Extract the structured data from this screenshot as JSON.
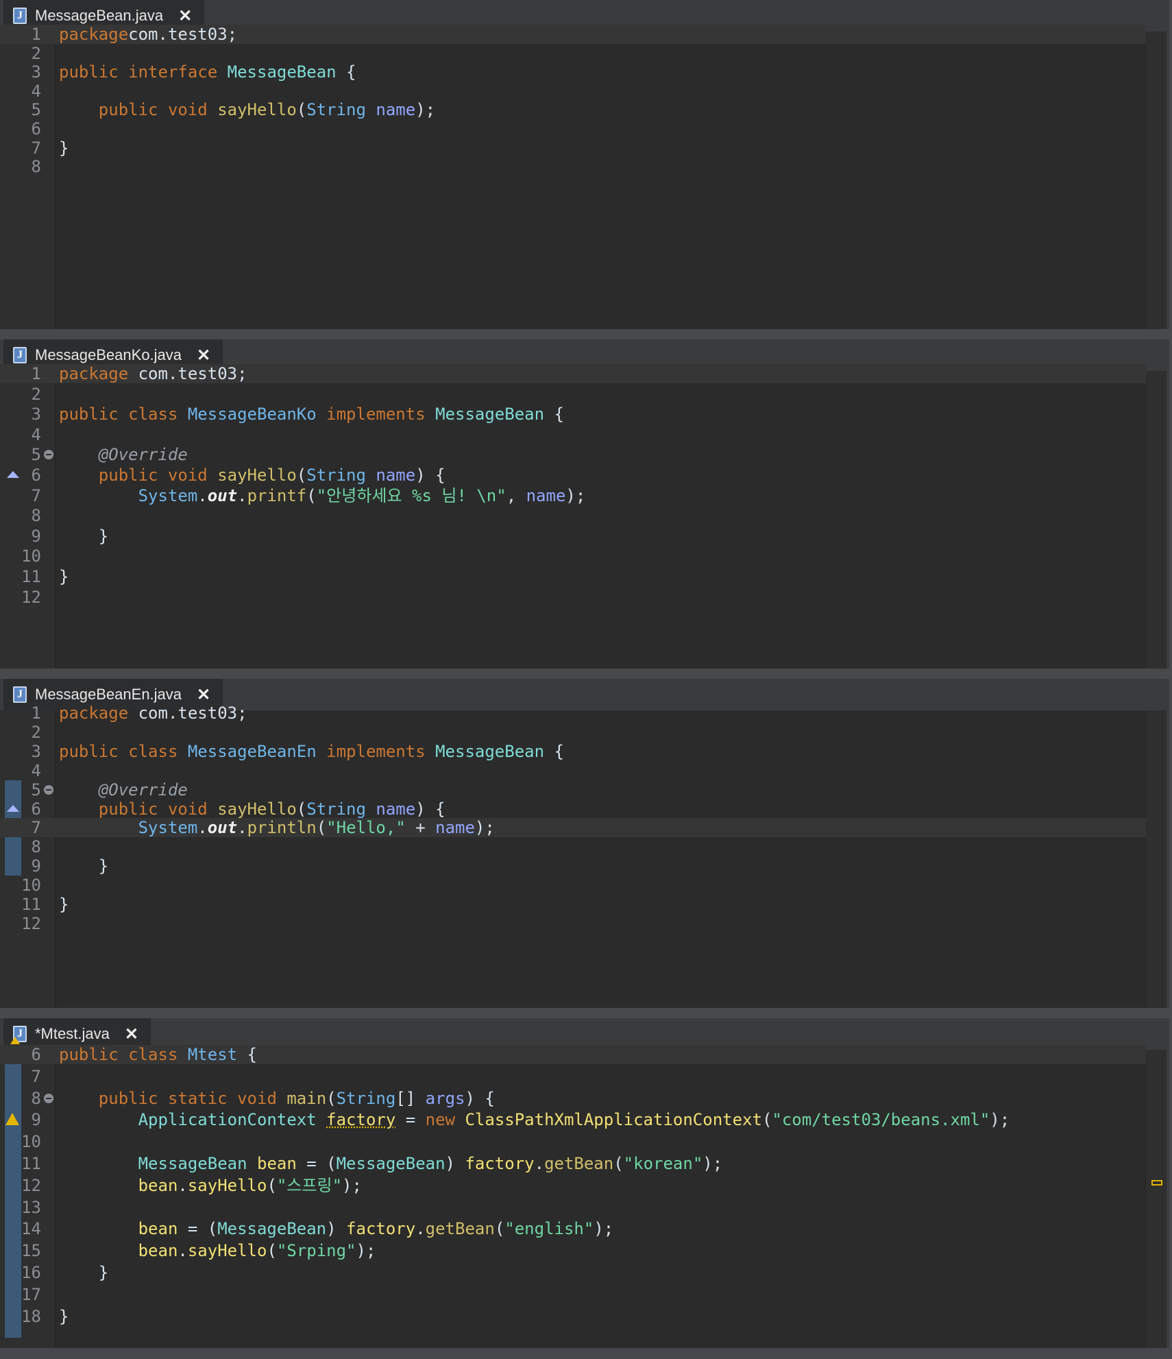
{
  "editors": [
    {
      "tab": {
        "label": "MessageBean.java",
        "close": "✕",
        "dirty": false
      },
      "lines": [
        {
          "n": "1",
          "code": [
            [
              "kw",
              "package"
            ],
            [
              "",
              "com.test03;"
            ]
          ]
        },
        {
          "n": "2",
          "code": []
        },
        {
          "n": "3",
          "code": [
            [
              "kw",
              "public"
            ],
            [
              "",
              " "
            ],
            [
              "kw",
              "interface"
            ],
            [
              "",
              " "
            ],
            [
              "ifc",
              "MessageBean"
            ],
            [
              "",
              " {"
            ]
          ]
        },
        {
          "n": "4",
          "code": []
        },
        {
          "n": "5",
          "code": [
            [
              "",
              "    "
            ],
            [
              "kw",
              "public"
            ],
            [
              "",
              " "
            ],
            [
              "kw",
              "void"
            ],
            [
              "",
              " "
            ],
            [
              "mth",
              "sayHello"
            ],
            [
              "",
              "("
            ],
            [
              "ty",
              "String"
            ],
            [
              "",
              " "
            ],
            [
              "prm",
              "name"
            ],
            [
              "",
              ");"
            ]
          ]
        },
        {
          "n": "6",
          "code": []
        },
        {
          "n": "7",
          "code": [
            [
              "",
              "}"
            ]
          ]
        },
        {
          "n": "8",
          "code": []
        }
      ]
    },
    {
      "tab": {
        "label": "MessageBeanKo.java",
        "close": "✕",
        "dirty": false
      },
      "lines": [
        {
          "n": "1",
          "code": [
            [
              "kw",
              "package"
            ],
            [
              "",
              " com.test03;"
            ]
          ]
        },
        {
          "n": "2",
          "code": []
        },
        {
          "n": "3",
          "code": [
            [
              "kw",
              "public"
            ],
            [
              "",
              " "
            ],
            [
              "kw",
              "class"
            ],
            [
              "",
              " "
            ],
            [
              "ty",
              "MessageBeanKo"
            ],
            [
              "",
              " "
            ],
            [
              "kw",
              "implements"
            ],
            [
              "",
              " "
            ],
            [
              "ifc",
              "MessageBean"
            ],
            [
              "",
              " {"
            ]
          ]
        },
        {
          "n": "4",
          "code": []
        },
        {
          "n": "5",
          "code": [
            [
              "",
              "    "
            ],
            [
              "ann",
              "@Override"
            ]
          ]
        },
        {
          "n": "6",
          "code": [
            [
              "",
              "    "
            ],
            [
              "kw",
              "public"
            ],
            [
              "",
              " "
            ],
            [
              "kw",
              "void"
            ],
            [
              "",
              " "
            ],
            [
              "mth",
              "sayHello"
            ],
            [
              "",
              "("
            ],
            [
              "ty",
              "String"
            ],
            [
              "",
              " "
            ],
            [
              "prm",
              "name"
            ],
            [
              "",
              ") {"
            ]
          ]
        },
        {
          "n": "7",
          "code": [
            [
              "",
              "        "
            ],
            [
              "ty",
              "System"
            ],
            [
              "",
              "."
            ],
            [
              "sfld",
              "out"
            ],
            [
              "",
              "."
            ],
            [
              "mth",
              "printf"
            ],
            [
              "",
              "("
            ],
            [
              "str",
              "\"안녕하세요 %s 님! \\n\""
            ],
            [
              "",
              ", "
            ],
            [
              "prm",
              "name"
            ],
            [
              "",
              ");"
            ]
          ]
        },
        {
          "n": "8",
          "code": []
        },
        {
          "n": "9",
          "code": [
            [
              "",
              "    }"
            ]
          ]
        },
        {
          "n": "10",
          "code": []
        },
        {
          "n": "11",
          "code": [
            [
              "",
              "}"
            ]
          ]
        },
        {
          "n": "12",
          "code": []
        }
      ]
    },
    {
      "tab": {
        "label": "MessageBeanEn.java",
        "close": "✕",
        "dirty": false
      },
      "lines": [
        {
          "n": "1",
          "code": [
            [
              "kw",
              "package"
            ],
            [
              "",
              " com.test03;"
            ]
          ]
        },
        {
          "n": "2",
          "code": []
        },
        {
          "n": "3",
          "code": [
            [
              "kw",
              "public"
            ],
            [
              "",
              " "
            ],
            [
              "kw",
              "class"
            ],
            [
              "",
              " "
            ],
            [
              "ty",
              "MessageBeanEn"
            ],
            [
              "",
              " "
            ],
            [
              "kw",
              "implements"
            ],
            [
              "",
              " "
            ],
            [
              "ifc",
              "MessageBean"
            ],
            [
              "",
              " {"
            ]
          ]
        },
        {
          "n": "4",
          "code": []
        },
        {
          "n": "5",
          "code": [
            [
              "",
              "    "
            ],
            [
              "ann",
              "@Override"
            ]
          ]
        },
        {
          "n": "6",
          "code": [
            [
              "",
              "    "
            ],
            [
              "kw",
              "public"
            ],
            [
              "",
              " "
            ],
            [
              "kw",
              "void"
            ],
            [
              "",
              " "
            ],
            [
              "mth",
              "sayHello"
            ],
            [
              "",
              "("
            ],
            [
              "ty",
              "String"
            ],
            [
              "",
              " "
            ],
            [
              "prm",
              "name"
            ],
            [
              "",
              ") {"
            ]
          ]
        },
        {
          "n": "7",
          "code": [
            [
              "",
              "        "
            ],
            [
              "ty",
              "System"
            ],
            [
              "",
              "."
            ],
            [
              "sfld",
              "out"
            ],
            [
              "",
              "."
            ],
            [
              "mth",
              "println"
            ],
            [
              "",
              "("
            ],
            [
              "str",
              "\"Hello,\""
            ],
            [
              "",
              " + "
            ],
            [
              "prm",
              "name"
            ],
            [
              "",
              ");"
            ]
          ]
        },
        {
          "n": "8",
          "code": []
        },
        {
          "n": "9",
          "code": [
            [
              "",
              "    }"
            ]
          ]
        },
        {
          "n": "10",
          "code": []
        },
        {
          "n": "11",
          "code": [
            [
              "",
              "}"
            ]
          ]
        },
        {
          "n": "12",
          "code": []
        }
      ]
    },
    {
      "tab": {
        "label": "*Mtest.java",
        "close": "✕",
        "dirty": true
      },
      "lines": [
        {
          "n": "6",
          "code": [
            [
              "kw",
              "public"
            ],
            [
              "",
              " "
            ],
            [
              "kw",
              "class"
            ],
            [
              "",
              " "
            ],
            [
              "ty",
              "Mtest"
            ],
            [
              "",
              " {"
            ]
          ]
        },
        {
          "n": "7",
          "code": []
        },
        {
          "n": "8",
          "code": [
            [
              "",
              "    "
            ],
            [
              "kw",
              "public"
            ],
            [
              "",
              " "
            ],
            [
              "kw",
              "static"
            ],
            [
              "",
              " "
            ],
            [
              "kw",
              "void"
            ],
            [
              "",
              " "
            ],
            [
              "mth",
              "main"
            ],
            [
              "",
              "("
            ],
            [
              "ty",
              "String"
            ],
            [
              "",
              "[] "
            ],
            [
              "prm",
              "args"
            ],
            [
              "",
              ") {"
            ]
          ]
        },
        {
          "n": "9",
          "code": [
            [
              "",
              "        "
            ],
            [
              "ifc",
              "ApplicationContext"
            ],
            [
              "",
              " "
            ],
            [
              "warnu",
              "factory"
            ],
            [
              "",
              " = "
            ],
            [
              "kw",
              "new"
            ],
            [
              "",
              " "
            ],
            [
              "var",
              "ClassPathXmlApplicationContext"
            ],
            [
              "",
              "("
            ],
            [
              "str",
              "\"com/test03/beans.xml\""
            ],
            [
              "",
              ");"
            ]
          ]
        },
        {
          "n": "10",
          "code": []
        },
        {
          "n": "11",
          "code": [
            [
              "",
              "        "
            ],
            [
              "ifc",
              "MessageBean"
            ],
            [
              "",
              " "
            ],
            [
              "var",
              "bean"
            ],
            [
              "",
              " = ("
            ],
            [
              "ifc",
              "MessageBean"
            ],
            [
              "",
              ") "
            ],
            [
              "var",
              "factory"
            ],
            [
              "",
              "."
            ],
            [
              "mth",
              "getBean"
            ],
            [
              "",
              "("
            ],
            [
              "str",
              "\"korean\""
            ],
            [
              "",
              ");"
            ]
          ]
        },
        {
          "n": "12",
          "code": [
            [
              "",
              "        "
            ],
            [
              "var",
              "bean"
            ],
            [
              "",
              "."
            ],
            [
              "var",
              "sayHello"
            ],
            [
              "",
              "("
            ],
            [
              "str",
              "\"스프링\""
            ],
            [
              "",
              ");"
            ]
          ]
        },
        {
          "n": "13",
          "code": []
        },
        {
          "n": "14",
          "code": [
            [
              "",
              "        "
            ],
            [
              "var",
              "bean"
            ],
            [
              "",
              " = ("
            ],
            [
              "ifc",
              "MessageBean"
            ],
            [
              "",
              ") "
            ],
            [
              "var",
              "factory"
            ],
            [
              "",
              "."
            ],
            [
              "mth",
              "getBean"
            ],
            [
              "",
              "("
            ],
            [
              "str",
              "\"english\""
            ],
            [
              "",
              ");"
            ]
          ]
        },
        {
          "n": "15",
          "code": [
            [
              "",
              "        "
            ],
            [
              "var",
              "bean"
            ],
            [
              "",
              "."
            ],
            [
              "var",
              "sayHello"
            ],
            [
              "",
              "("
            ],
            [
              "str",
              "\"Srping\""
            ],
            [
              "",
              ");"
            ]
          ]
        },
        {
          "n": "16",
          "code": [
            [
              "",
              "    }"
            ]
          ]
        },
        {
          "n": "17",
          "code": []
        },
        {
          "n": "18",
          "code": [
            [
              "",
              "}"
            ]
          ]
        }
      ]
    }
  ],
  "colors": {
    "editor_bg": "#2b2b2b",
    "keyword": "#cc7832",
    "type": "#6fb5e9",
    "interface": "#7fdcd6",
    "method": "#d2bf6a",
    "param": "#92a6ff",
    "string": "#6fd6a5"
  }
}
